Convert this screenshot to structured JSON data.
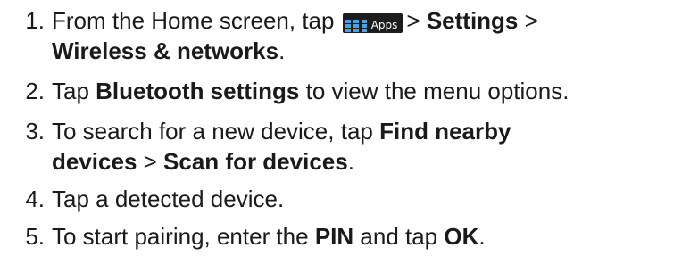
{
  "steps": [
    {
      "number": "1.",
      "before": "From the Home screen, tap",
      "apps_button_label": "Apps",
      "after_apps": "> ",
      "settings": "Settings",
      "after_settings": " >",
      "wireless": "Wireless & networks",
      "end": "."
    },
    {
      "number": "2.",
      "before": "Tap ",
      "bold": "Bluetooth settings",
      "after": " to view the menu options."
    },
    {
      "number": "3.",
      "before": "To search for a new device, tap ",
      "bold1": "Find nearby",
      "bold1b": "devices",
      "mid": " > ",
      "bold2": "Scan for devices",
      "end": "."
    },
    {
      "number": "4.",
      "text": "Tap a detected device."
    },
    {
      "number": "5.",
      "before": "To start pairing, enter the ",
      "bold1": "PIN",
      "mid": " and tap ",
      "bold2": "OK",
      "end": "."
    }
  ],
  "icons": {
    "apps": "apps-grid-icon"
  },
  "colors": {
    "text": "#1a1a1a",
    "apps_button_bg": "#1c1c1c",
    "apps_grid": "#4aa3df"
  }
}
